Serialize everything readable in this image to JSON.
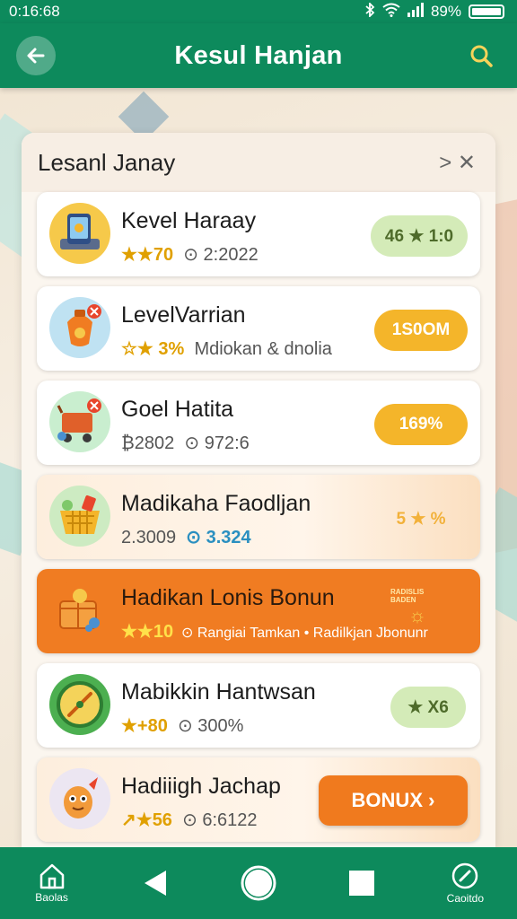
{
  "status_bar": {
    "time": "0:16:68",
    "battery_text": "89%"
  },
  "app_bar": {
    "title": "Kesul Hanjan"
  },
  "panel": {
    "title": "Lesanl Janay",
    "close_text": "> ✕"
  },
  "rows": [
    {
      "title": "Kevel Haraay",
      "sub_a": "★★70",
      "sub_b": "⊙ 2:2022",
      "badge": "46 ★ 1:0",
      "style": "green",
      "icon": "phone-icon"
    },
    {
      "title": "LevelVarrian",
      "sub_a": "☆★ 3%",
      "sub_b": "Mdiokan & dnolia",
      "badge": "1S0OM",
      "style": "gold",
      "icon": "lantern-icon"
    },
    {
      "title": "Goel Hatita",
      "sub_a": "₿2802",
      "sub_b": "⊙ 972:6",
      "badge": "169%",
      "style": "gold",
      "icon": "cart-icon"
    },
    {
      "title": "Madikaha Faodljan",
      "sub_a": "2.3009",
      "sub_b": "⊙ 3.324",
      "badge": "5 ★ %",
      "style": "clear",
      "icon": "basket-icon"
    },
    {
      "title": "Hadikan Lonis Bonun",
      "sub_a": "★★10",
      "sub_b": "⊙ Rangiai Tamkan • Radilkjan Jbonunr",
      "badge_top": "RADISLIS BADEN",
      "badge": "☼",
      "style": "orange-small",
      "icon": "box-icon"
    },
    {
      "title": "Mabikkin Hantwsan",
      "sub_a": "★+80",
      "sub_b": "⊙ 300%",
      "badge": "★ X6",
      "style": "green",
      "icon": "compass-icon"
    },
    {
      "title": "Hadiiigh Jachap",
      "sub_a": "↗★56",
      "sub_b": "⊙ 6:6122",
      "badge": "BONUX ›",
      "style": "bonus",
      "icon": "mascot-icon"
    }
  ],
  "bottom_nav": {
    "left_label": "Baolas",
    "right_label": "Caoitdo"
  },
  "colors": {
    "primary": "#0d8a5c",
    "accent_orange": "#f07c22",
    "gold": "#f4b52a"
  }
}
